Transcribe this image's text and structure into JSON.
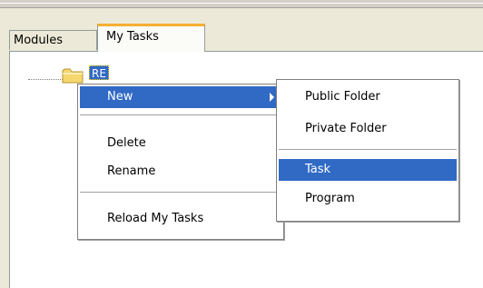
{
  "tabs": [
    {
      "label": "Modules",
      "active": false
    },
    {
      "label": "My Tasks",
      "active": true
    }
  ],
  "tree": {
    "root_label": "RE"
  },
  "context_menu": {
    "new_label": "New",
    "delete_label": "Delete",
    "rename_label": "Rename",
    "reload_label": "Reload My Tasks"
  },
  "submenu": {
    "public_folder_label": "Public Folder",
    "private_folder_label": "Private Folder",
    "task_label": "Task",
    "program_label": "Program"
  },
  "colors": {
    "selection": "#316ac5",
    "tab_accent": "#f5b031",
    "folder": "#f5d76e"
  }
}
